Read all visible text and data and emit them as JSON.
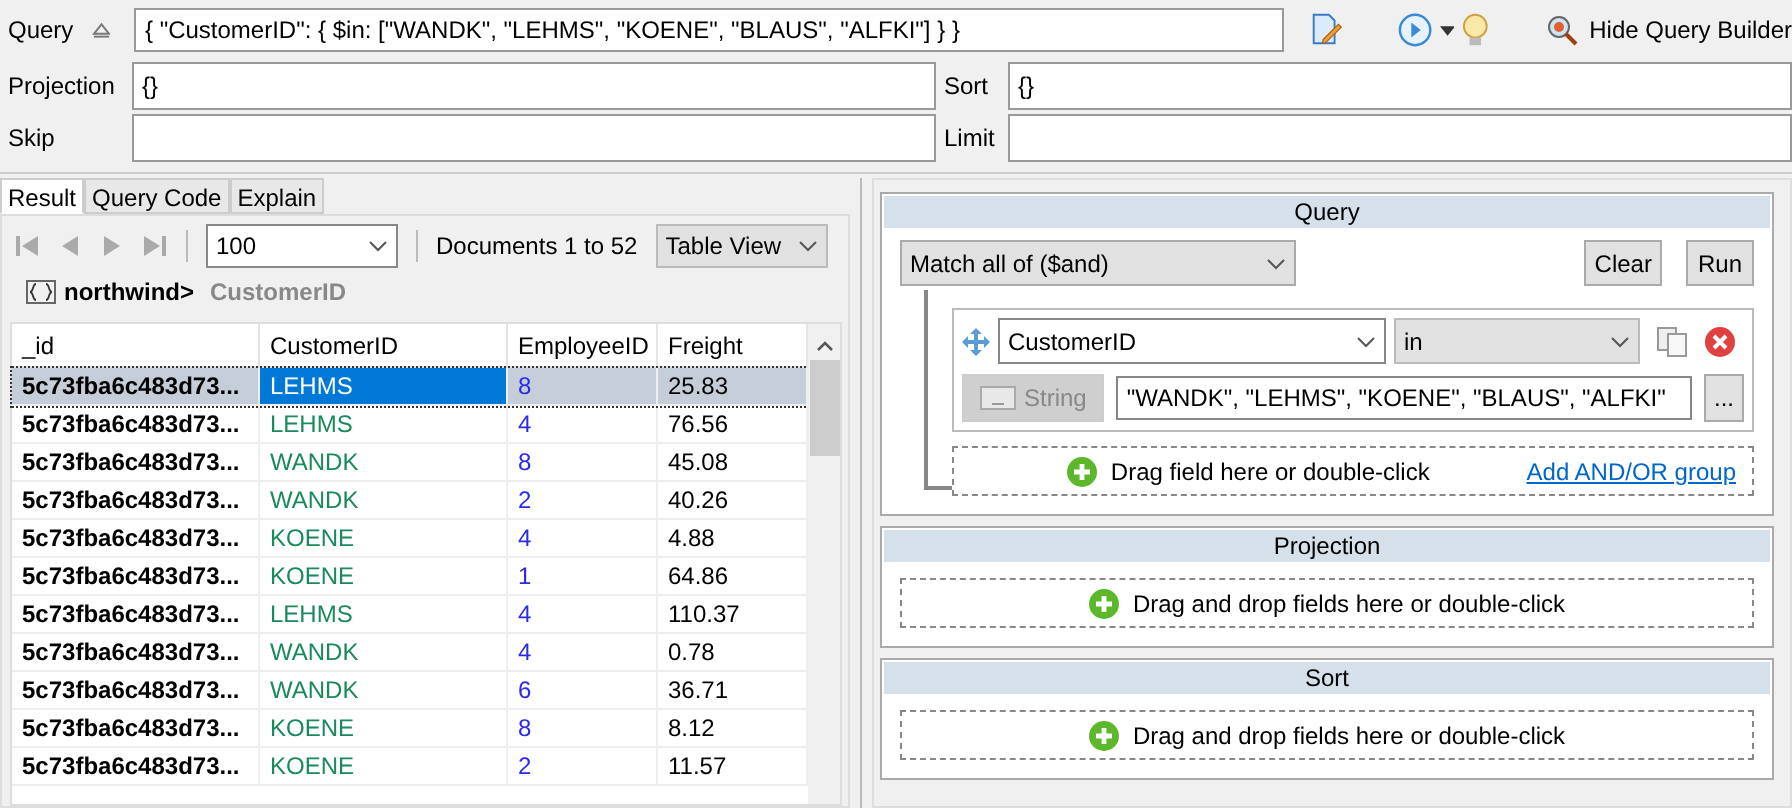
{
  "query_bar": {
    "label": "Query",
    "value": "{ \"CustomerID\": { $in: [\"WANDK\", \"LEHMS\", \"KOENE\", \"BLAUS\", \"ALFKI\"] } }",
    "hide_builder": "Hide Query Builder"
  },
  "projection": {
    "label": "Projection",
    "value": "{}"
  },
  "sort": {
    "label": "Sort",
    "value": "{}"
  },
  "skip": {
    "label": "Skip"
  },
  "limit": {
    "label": "Limit"
  },
  "tabs": [
    {
      "label": "Result",
      "selected": true
    },
    {
      "label": "Query Code",
      "selected": false
    },
    {
      "label": "Explain",
      "selected": false
    }
  ],
  "pager": {
    "page_size": "100",
    "documents": "Documents 1 to 52",
    "view": "Table View"
  },
  "breadcrumb": {
    "database": "northwind>",
    "field": "CustomerID"
  },
  "table": {
    "columns": [
      "_id",
      "CustomerID",
      "EmployeeID",
      "Freight"
    ],
    "rows": [
      {
        "cells": [
          "5c73fba6c483d73...",
          "LEHMS",
          "8",
          "25.83"
        ],
        "selected": true
      },
      {
        "cells": [
          "5c73fba6c483d73...",
          "LEHMS",
          "4",
          "76.56"
        ],
        "selected": false
      },
      {
        "cells": [
          "5c73fba6c483d73...",
          "WANDK",
          "8",
          "45.08"
        ],
        "selected": false
      },
      {
        "cells": [
          "5c73fba6c483d73...",
          "WANDK",
          "2",
          "40.26"
        ],
        "selected": false
      },
      {
        "cells": [
          "5c73fba6c483d73...",
          "KOENE",
          "4",
          "4.88"
        ],
        "selected": false
      },
      {
        "cells": [
          "5c73fba6c483d73...",
          "KOENE",
          "1",
          "64.86"
        ],
        "selected": false
      },
      {
        "cells": [
          "5c73fba6c483d73...",
          "LEHMS",
          "4",
          "110.37"
        ],
        "selected": false
      },
      {
        "cells": [
          "5c73fba6c483d73...",
          "WANDK",
          "4",
          "0.78"
        ],
        "selected": false
      },
      {
        "cells": [
          "5c73fba6c483d73...",
          "WANDK",
          "6",
          "36.71"
        ],
        "selected": false
      },
      {
        "cells": [
          "5c73fba6c483d73...",
          "KOENE",
          "8",
          "8.12"
        ],
        "selected": false
      },
      {
        "cells": [
          "5c73fba6c483d73...",
          "KOENE",
          "2",
          "11.57"
        ],
        "selected": false
      }
    ]
  },
  "builder": {
    "query": {
      "title": "Query",
      "match": "Match all of ($and)",
      "clear": "Clear",
      "run": "Run",
      "condition": {
        "field": "CustomerID",
        "operator": "in",
        "type": "String",
        "type_disabled": true,
        "value": "\"WANDK\", \"LEHMS\", \"KOENE\", \"BLAUS\", \"ALFKI\"",
        "more": "..."
      },
      "drop": "Drag field here or double-click",
      "add_group": "Add AND/OR group"
    },
    "projection": {
      "title": "Projection",
      "drop": "Drag and drop fields here or double-click"
    },
    "sort": {
      "title": "Sort",
      "drop": "Drag and drop fields here or double-click"
    }
  }
}
